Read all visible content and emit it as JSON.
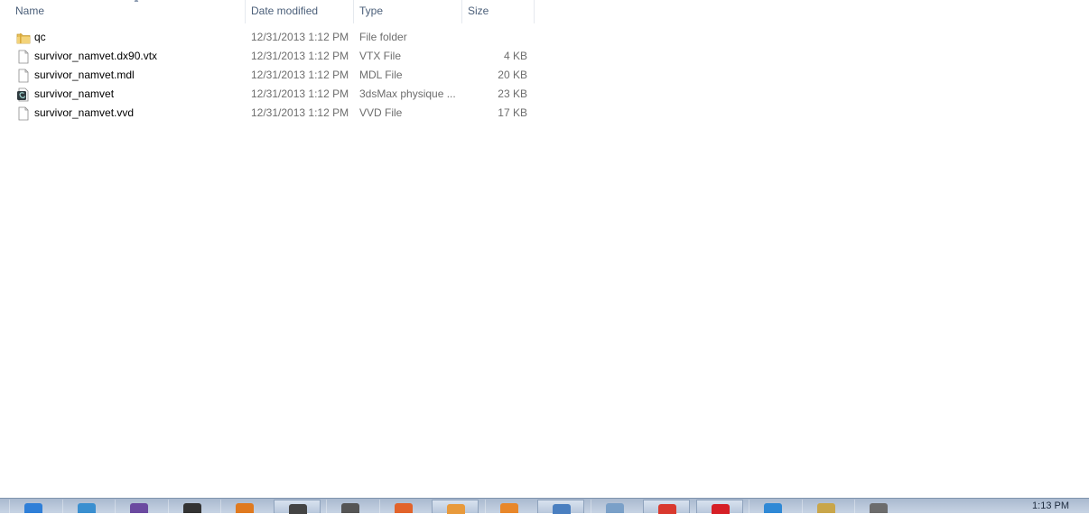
{
  "columns": {
    "name": "Name",
    "date": "Date modified",
    "type": "Type",
    "size": "Size"
  },
  "files": [
    {
      "icon": "folder-icon",
      "name": "qc",
      "date": "12/31/2013 1:12 PM",
      "type": "File folder",
      "size": ""
    },
    {
      "icon": "file-icon",
      "name": "survivor_namvet.dx90.vtx",
      "date": "12/31/2013 1:12 PM",
      "type": "VTX File",
      "size": "4 KB"
    },
    {
      "icon": "file-icon",
      "name": "survivor_namvet.mdl",
      "date": "12/31/2013 1:12 PM",
      "type": "MDL File",
      "size": "20 KB"
    },
    {
      "icon": "3dsmax-physique-icon",
      "name": "survivor_namvet",
      "date": "12/31/2013 1:12 PM",
      "type": "3dsMax physique ...",
      "size": "23 KB"
    },
    {
      "icon": "file-icon",
      "name": "survivor_namvet.vvd",
      "date": "12/31/2013 1:12 PM",
      "type": "VVD File",
      "size": "17 KB"
    }
  ],
  "taskbar": {
    "clock": "1:13 PM",
    "apps": [
      {
        "name": "start-icon",
        "color": "#2f7fd8"
      },
      {
        "name": "app-bird-icon",
        "color": "#3a8fd0"
      },
      {
        "name": "app-media-icon",
        "color": "#6b4aa0"
      },
      {
        "name": "app-tent-icon",
        "color": "#333333"
      },
      {
        "name": "app-fox-icon",
        "color": "#e07a1f"
      },
      {
        "name": "app-camera-icon",
        "color": "#444444"
      },
      {
        "name": "app-shield-icon",
        "color": "#555555"
      },
      {
        "name": "app-flame-icon",
        "color": "#e2632a"
      },
      {
        "name": "app-explorer-icon",
        "color": "#e89a3c"
      },
      {
        "name": "app-cone-icon",
        "color": "#e8872a"
      },
      {
        "name": "app-window-icon",
        "color": "#4a7fc0"
      },
      {
        "name": "app-notepad-icon",
        "color": "#7aa0c8"
      },
      {
        "name": "app-chrome-icon",
        "color": "#d9392e"
      },
      {
        "name": "app-red-icon",
        "color": "#d61f26"
      },
      {
        "name": "app-ie-icon",
        "color": "#2f89d6"
      },
      {
        "name": "app-picture-icon",
        "color": "#c9a64a"
      },
      {
        "name": "app-folders-icon",
        "color": "#6c6c6c"
      }
    ]
  }
}
